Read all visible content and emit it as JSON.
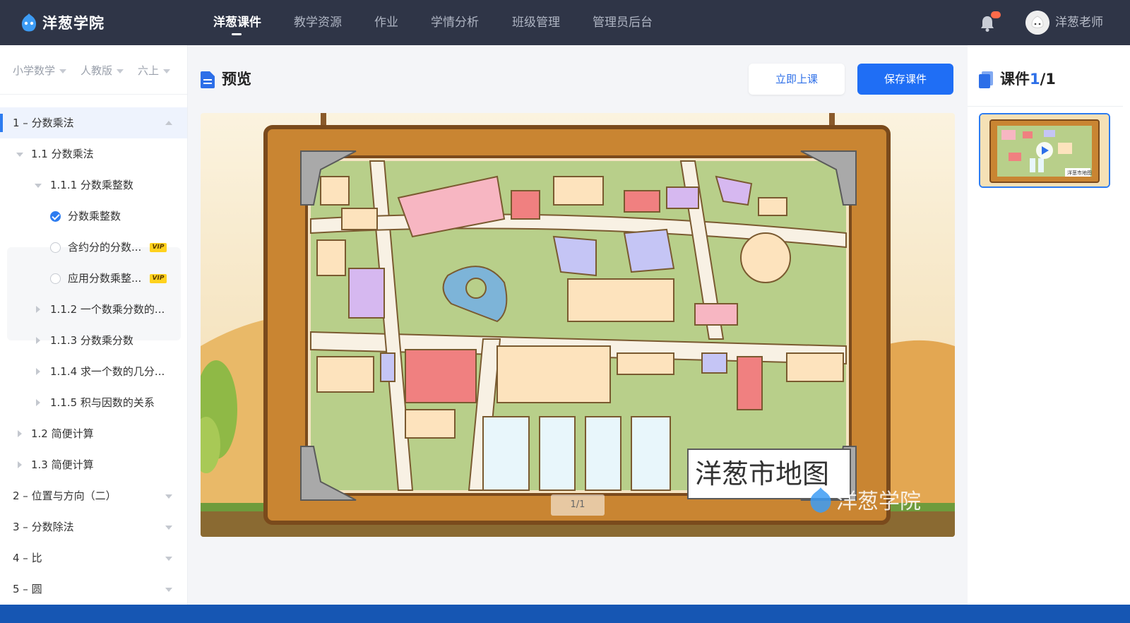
{
  "app": {
    "name": "洋葱学院",
    "brand_color": "#2f3547",
    "accent_color": "#1f6ef5"
  },
  "nav": {
    "items": [
      {
        "label": "洋葱课件",
        "active": true
      },
      {
        "label": "教学资源",
        "active": false
      },
      {
        "label": "作业",
        "active": false
      },
      {
        "label": "学情分析",
        "active": false
      },
      {
        "label": "班级管理",
        "active": false
      },
      {
        "label": "管理员后台",
        "active": false
      }
    ],
    "bell_icon": "bell-icon",
    "user_name": "洋葱老师"
  },
  "filters": {
    "subject": "小学数学",
    "edition": "人教版",
    "grade": "六上"
  },
  "tree": {
    "items": [
      {
        "label": "1 – 分数乘法",
        "level": 0,
        "selected": true,
        "expanded": true
      },
      {
        "label": "1.1 分数乘法",
        "level": 1,
        "expanded": true
      },
      {
        "label": "1.1.1 分数乘整数",
        "level": 2,
        "expanded": true
      },
      {
        "label": "分数乘整数",
        "level": 3,
        "checked": true
      },
      {
        "label": "含约分的分数...",
        "level": 3,
        "vip": "VIP"
      },
      {
        "label": "应用分数乘整...",
        "level": 3,
        "vip": "VIP"
      },
      {
        "label": "1.1.2 一个数乘分数的...",
        "level": 2
      },
      {
        "label": "1.1.3 分数乘分数",
        "level": 2
      },
      {
        "label": "1.1.4 求一个数的几分...",
        "level": 2
      },
      {
        "label": "1.1.5 积与因数的关系",
        "level": 2
      },
      {
        "label": "1.2 简便计算",
        "level": 1
      },
      {
        "label": "1.3 简便计算",
        "level": 1
      },
      {
        "label": "2 – 位置与方向（二）",
        "level": 0
      },
      {
        "label": "3 – 分数除法",
        "level": 0
      },
      {
        "label": "4 – 比",
        "level": 0
      },
      {
        "label": "5 – 圆",
        "level": 0
      }
    ]
  },
  "main": {
    "title": "预览",
    "start_button": "立即上课",
    "save_button": "保存课件",
    "slide": {
      "sign_text": "洋葱市地图",
      "logo_text": "洋葱学院",
      "page_indicator": "1/1"
    }
  },
  "right_panel": {
    "title_prefix": "课件",
    "current": "1",
    "total": "/1",
    "thumb_label": "洋葱市地图"
  }
}
